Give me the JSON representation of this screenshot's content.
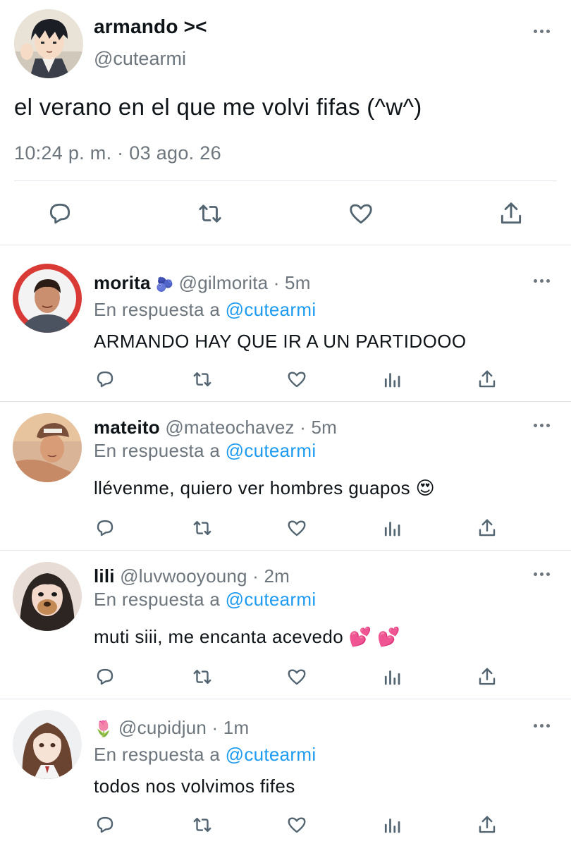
{
  "tweet": {
    "author_name": "armando ><",
    "author_handle": "@cutearmi",
    "text": "el verano en el que me volvi fifas (^w^)",
    "meta": "10:24 p. m. · 03 ago. 26"
  },
  "replies": [
    {
      "name": "morita",
      "badge": "🫐",
      "handle": "@gilmorita",
      "time": "· 5m",
      "reply_prefix": "En respuesta a",
      "reply_target": "@cutearmi",
      "text": "ARMANDO HAY QUE IR A UN PARTIDOOO"
    },
    {
      "name": "mateito",
      "handle": "@mateochavez",
      "time": "· 5m",
      "reply_prefix": "En respuesta a",
      "reply_target": "@cutearmi",
      "text": "llévenme, quiero ver hombres guapos 😍"
    },
    {
      "name": "lili",
      "handle": "@luvwooyoung",
      "time": "· 2m",
      "reply_prefix": "En respuesta a",
      "reply_target": "@cutearmi",
      "text": "muti siii, me encanta acevedo 💕 💕"
    },
    {
      "name": "🌷",
      "handle": "@cupidjun",
      "time": "· 1m",
      "reply_prefix": "En respuesta a",
      "reply_target": "@cutearmi",
      "text": "todos nos volvimos fifes"
    }
  ],
  "icons": {
    "reply": "reply-bubble-icon",
    "retweet": "retweet-icon",
    "like": "heart-icon",
    "views": "bar-chart-icon",
    "share": "share-icon",
    "more": "more-dots-icon"
  },
  "colors": {
    "text": "#0f1419",
    "secondary": "#6e767d",
    "link": "#1d9bf0",
    "divider": "#e1e4e8"
  }
}
